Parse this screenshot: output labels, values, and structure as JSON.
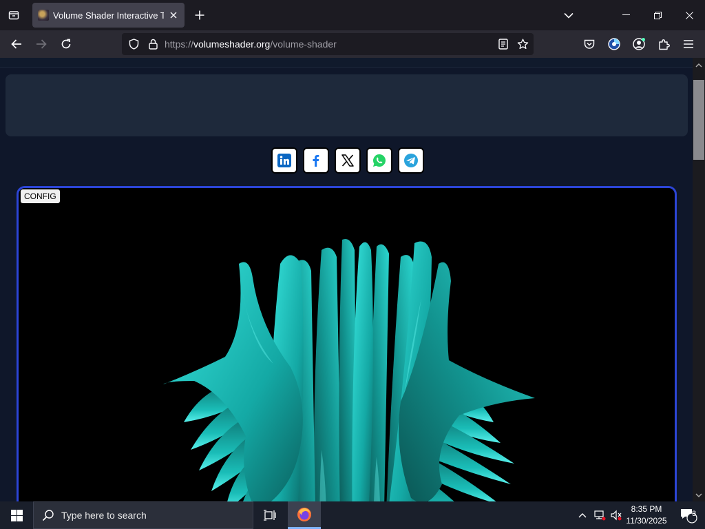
{
  "browser": {
    "tab": {
      "title": "Volume Shader Interactive Tool"
    },
    "url": {
      "scheme": "https://",
      "domain": "volumeshader.org",
      "path": "/volume-shader"
    }
  },
  "page": {
    "share_buttons": [
      {
        "name": "linkedin",
        "color": "#0a66c2"
      },
      {
        "name": "facebook",
        "color": "#1877f2"
      },
      {
        "name": "x",
        "color": "#000000"
      },
      {
        "name": "whatsapp",
        "color": "#25d366"
      },
      {
        "name": "telegram",
        "color": "#2aa3dc"
      }
    ],
    "config_label": "CONFIG",
    "accent_border": "#2c45d6",
    "shader_color": "#1fc2bd"
  },
  "taskbar": {
    "search_placeholder": "Type here to search",
    "time": "8:35 PM",
    "date": "11/30/2025",
    "notification_count": "3"
  }
}
